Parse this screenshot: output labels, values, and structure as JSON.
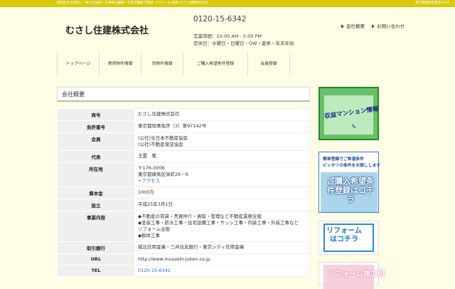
{
  "topbar": {
    "tagline": "練馬区の土地探し・富士見台駅・石神井公園駅・大泉学園駅 不動産 リフォーム 売買 むさし住建株式会社",
    "right_text": "東京都練馬区貫井2-6-6"
  },
  "header": {
    "logo": "むさし住建株式会社",
    "tel": "0120-15-6342",
    "hours_line": "営業時間：10:00 AM - 5:00 PM",
    "holiday_line": "定休日：水曜日・日曜日・GW・夏季・年末年始",
    "links": [
      "会社概要",
      "お問い合わせ"
    ]
  },
  "nav": [
    "トップページ",
    "賃貸物件情報",
    "売物件情報",
    "ご購入希望条件登録",
    "会員登録"
  ],
  "section_title": "会社概要",
  "company_table": [
    {
      "label": "商号",
      "lines": [
        "むさし住建株式会社"
      ]
    },
    {
      "label": "免許番号",
      "lines": [
        "東京都知事免許（3）第97142号"
      ]
    },
    {
      "label": "会員",
      "lines": [
        "(公社)全日本不動産協会",
        "(公社)不動産保証協会"
      ]
    },
    {
      "label": "代表",
      "lines": [
        "玉置　篤"
      ]
    },
    {
      "label": "所在地",
      "lines": [
        "〒176-0006",
        "東京都練馬区栄町26－6"
      ],
      "link": "+アクセス"
    },
    {
      "label": "資本金",
      "lines": [
        "1000万"
      ]
    },
    {
      "label": "設立",
      "lines": [
        "平成25年3月1日"
      ]
    },
    {
      "label": "事業内容",
      "lines": [
        "◆不動産の賃貸・売買仲介・貢取・管理など不動産業務全般",
        "◆塗装工事・防水工事・住宅設備工事・サッシ工事・内装工事・外装工事など",
        "リフォーム全般",
        "◆解体工事"
      ]
    },
    {
      "label": "取引銀行",
      "lines": [
        "城北信用金庫・三井住友銀行・東京シティ信用金庫"
      ]
    },
    {
      "label": "URL",
      "lines": [
        "http://www.musashi-juken.co.jp"
      ]
    },
    {
      "label": "TEL",
      "lines": [],
      "link": "0120-15-6342"
    }
  ],
  "sidebar": {
    "banner1_text": "収益マンション情報",
    "banner2_line1": "簡単登録でご希望条件",
    "banner2_line2": "ピッタリの条件をお探しします",
    "banner2_main": "ご購入希望条件登録はコチラ",
    "banner3_text": "リフォームはコチラ",
    "banner4_text": "リフォーム施工例"
  }
}
